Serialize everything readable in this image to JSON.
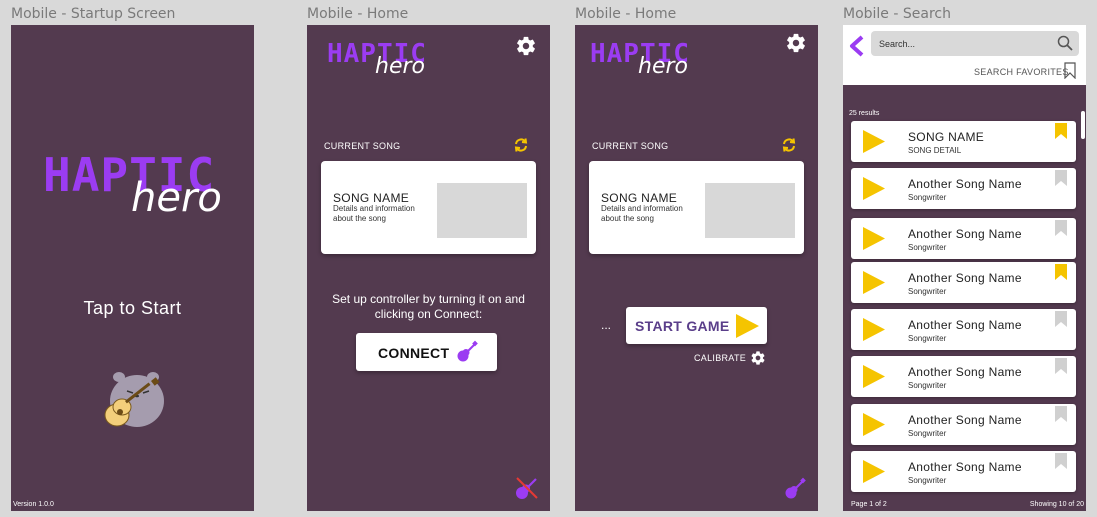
{
  "frames": {
    "startup": "Mobile - Startup Screen",
    "home1": "Mobile - Home",
    "home2": "Mobile - Home",
    "search": "Mobile - Search"
  },
  "logo": {
    "word1": "HAPTIC",
    "word2": "hero"
  },
  "startup": {
    "tap_to_start": "Tap to Start",
    "version": "Version 1.0.0"
  },
  "home1": {
    "current_song": "CURRENT SONG",
    "song_name": "SONG NAME",
    "song_details": "Details and information about the song",
    "instructions": "Set up controller by turning it on and clicking on Connect:",
    "connect": "CONNECT"
  },
  "home2": {
    "current_song": "CURRENT SONG",
    "song_name": "SONG NAME",
    "song_details": "Details and information about the song",
    "ellipsis": "...",
    "start_game": "START GAME",
    "calibrate": "CALIBRATE"
  },
  "search": {
    "placeholder": "Search...",
    "favorites": "SEARCH FAVORITES",
    "results": "25  results",
    "page": "Page 1 of 2",
    "showing": "Showing 10 of 20",
    "items": [
      {
        "title": "SONG NAME",
        "subtitle": "SONG DETAIL",
        "favorite": true
      },
      {
        "title": "Another Song Name",
        "subtitle": "Songwriter",
        "favorite": false
      },
      {
        "title": "Another Song Name",
        "subtitle": "Songwriter",
        "favorite": false
      },
      {
        "title": "Another Song Name",
        "subtitle": "Songwriter",
        "favorite": true
      },
      {
        "title": "Another Song Name",
        "subtitle": "Songwriter",
        "favorite": false
      },
      {
        "title": "Another Song Name",
        "subtitle": "Songwriter",
        "favorite": false
      },
      {
        "title": "Another Song Name",
        "subtitle": "Songwriter",
        "favorite": false
      },
      {
        "title": "Another Song Name",
        "subtitle": "Songwriter",
        "favorite": false
      }
    ]
  },
  "colors": {
    "background": "#533a4f",
    "accent_purple": "#9b3cf2",
    "accent_yellow": "#f5c400",
    "disconnect_red": "#e53935"
  },
  "icons": [
    "gear-icon",
    "sync-icon",
    "guitar-icon",
    "play-icon",
    "bookmark-icon",
    "search-icon",
    "back-chevron-icon",
    "mascot-icon"
  ]
}
